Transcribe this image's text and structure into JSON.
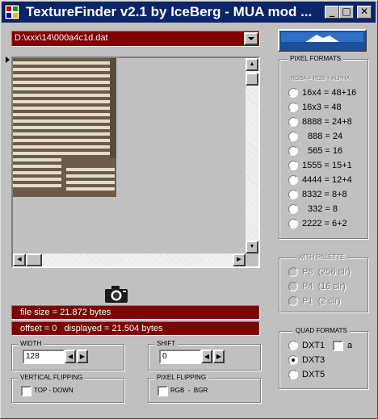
{
  "window": {
    "title": "TextureFinder v2.1 by IceBerg - MUA mod ..."
  },
  "titlebar_buttons": {
    "minimize": "_",
    "maximize": "□",
    "close": "✕"
  },
  "file": {
    "path": "D:\\xxx\\14\\000a4c1d.dat"
  },
  "info": {
    "file_size": "file size = 21.872 bytes",
    "offset_line": "offset = 0   displayed = 21.504 bytes"
  },
  "width": {
    "label": "WIDTH",
    "value": "128"
  },
  "shift": {
    "label": "SHIFT",
    "value": "0"
  },
  "vertical_flipping": {
    "label": "VERTICAL FLIPPING",
    "checkbox": "TOP - DOWN"
  },
  "pixel_flipping": {
    "label": "PIXEL FLIPPING",
    "checkbox": "RGB  -  BGR"
  },
  "pixel_formats": {
    "label": "PIXEL FORMATS",
    "sublabel": "RGBA = RGB + ALPHA",
    "options": [
      "16x4 = 48+16",
      "16x3 = 48",
      "8888 = 24+8",
      "888 = 24",
      "565 = 16",
      "1555 = 15+1",
      "4444 = 12+4",
      "8332 = 8+8",
      "332 = 8",
      "2222 = 6+2"
    ]
  },
  "with_palette": {
    "label": "WITH PALETTE",
    "options": [
      "P8  (256 clr)",
      "P4  (16 clr)",
      "P1  (2 clr)"
    ]
  },
  "quad_formats": {
    "label": "QUAD FORMATS",
    "options": [
      "DXT1",
      "DXT3",
      "DXT5"
    ],
    "selected": "DXT3",
    "alpha_label": "a"
  },
  "icons": [
    "app-icon",
    "camera-icon",
    "logo-iceberg-icon",
    "dropdown-arrow-icon"
  ]
}
